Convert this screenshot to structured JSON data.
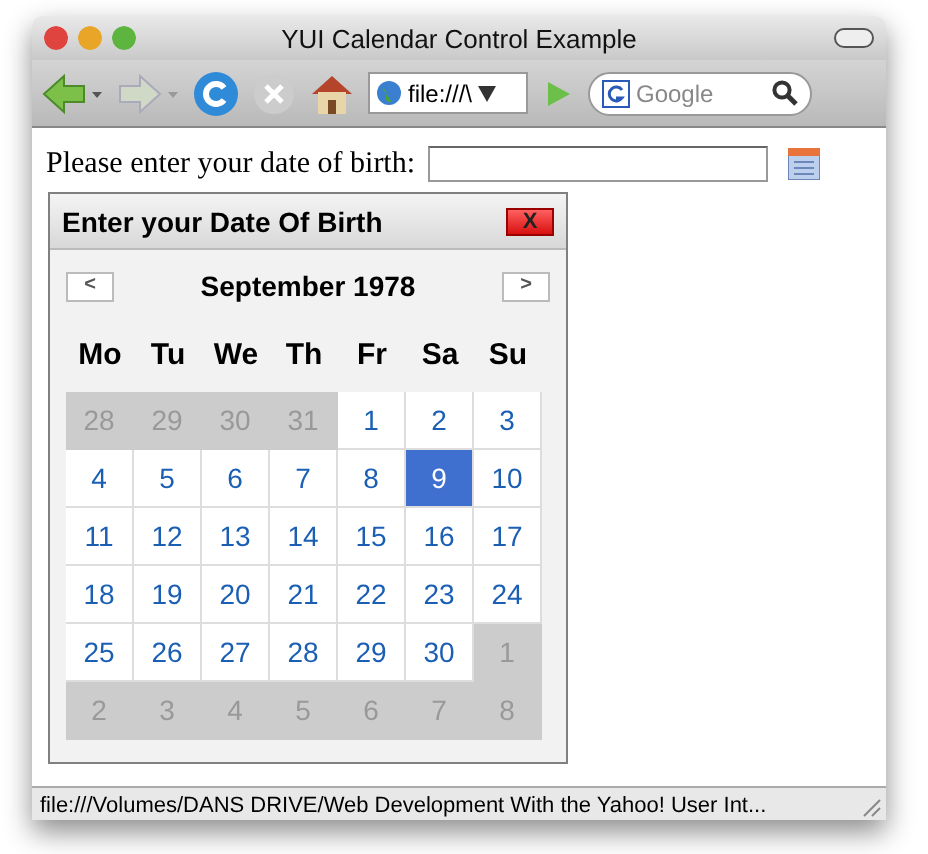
{
  "window": {
    "title": "YUI Calendar Control Example"
  },
  "toolbar": {
    "address": "file:///\\",
    "search": {
      "placeholder": "Google"
    }
  },
  "form": {
    "label": "Please enter your date of birth:"
  },
  "calendar": {
    "title": "Enter your Date Of Birth",
    "close": "X",
    "prev": "<",
    "next": ">",
    "month": "September 1978",
    "weekdays": [
      "Mo",
      "Tu",
      "We",
      "Th",
      "Fr",
      "Sa",
      "Su"
    ],
    "days": [
      {
        "text": "28",
        "outside": true,
        "selected": false
      },
      {
        "text": "29",
        "outside": true,
        "selected": false
      },
      {
        "text": "30",
        "outside": true,
        "selected": false
      },
      {
        "text": "31",
        "outside": true,
        "selected": false
      },
      {
        "text": "1",
        "outside": false,
        "selected": false
      },
      {
        "text": "2",
        "outside": false,
        "selected": false
      },
      {
        "text": "3",
        "outside": false,
        "selected": false
      },
      {
        "text": "4",
        "outside": false,
        "selected": false
      },
      {
        "text": "5",
        "outside": false,
        "selected": false
      },
      {
        "text": "6",
        "outside": false,
        "selected": false
      },
      {
        "text": "7",
        "outside": false,
        "selected": false
      },
      {
        "text": "8",
        "outside": false,
        "selected": false
      },
      {
        "text": "9",
        "outside": false,
        "selected": true
      },
      {
        "text": "10",
        "outside": false,
        "selected": false
      },
      {
        "text": "11",
        "outside": false,
        "selected": false
      },
      {
        "text": "12",
        "outside": false,
        "selected": false
      },
      {
        "text": "13",
        "outside": false,
        "selected": false
      },
      {
        "text": "14",
        "outside": false,
        "selected": false
      },
      {
        "text": "15",
        "outside": false,
        "selected": false
      },
      {
        "text": "16",
        "outside": false,
        "selected": false
      },
      {
        "text": "17",
        "outside": false,
        "selected": false
      },
      {
        "text": "18",
        "outside": false,
        "selected": false
      },
      {
        "text": "19",
        "outside": false,
        "selected": false
      },
      {
        "text": "20",
        "outside": false,
        "selected": false
      },
      {
        "text": "21",
        "outside": false,
        "selected": false
      },
      {
        "text": "22",
        "outside": false,
        "selected": false
      },
      {
        "text": "23",
        "outside": false,
        "selected": false
      },
      {
        "text": "24",
        "outside": false,
        "selected": false
      },
      {
        "text": "25",
        "outside": false,
        "selected": false
      },
      {
        "text": "26",
        "outside": false,
        "selected": false
      },
      {
        "text": "27",
        "outside": false,
        "selected": false
      },
      {
        "text": "28",
        "outside": false,
        "selected": false
      },
      {
        "text": "29",
        "outside": false,
        "selected": false
      },
      {
        "text": "30",
        "outside": false,
        "selected": false
      },
      {
        "text": "1",
        "outside": true,
        "selected": false
      },
      {
        "text": "2",
        "outside": true,
        "selected": false
      },
      {
        "text": "3",
        "outside": true,
        "selected": false
      },
      {
        "text": "4",
        "outside": true,
        "selected": false
      },
      {
        "text": "5",
        "outside": true,
        "selected": false
      },
      {
        "text": "6",
        "outside": true,
        "selected": false
      },
      {
        "text": "7",
        "outside": true,
        "selected": false
      },
      {
        "text": "8",
        "outside": true,
        "selected": false
      }
    ]
  },
  "status_bar": {
    "text": "file:///Volumes/DANS DRIVE/Web Development With the Yahoo! User Int..."
  }
}
